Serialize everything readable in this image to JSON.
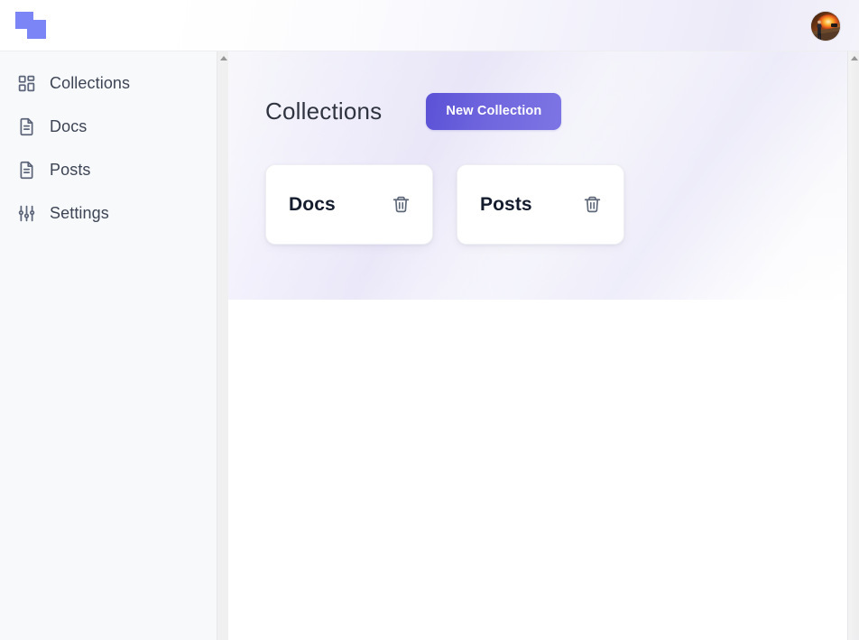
{
  "app": {
    "logo_name": "overlapping-squares-logo",
    "accent_color": "#6a61db",
    "logo_color": "#7c85f5",
    "sidebar_bg": "#f8f9fb"
  },
  "topbar": {
    "avatar_alt": "user-avatar"
  },
  "sidebar": {
    "items": [
      {
        "label": "Collections",
        "icon": "grid-icon"
      },
      {
        "label": "Docs",
        "icon": "document-icon"
      },
      {
        "label": "Posts",
        "icon": "document-icon"
      },
      {
        "label": "Settings",
        "icon": "sliders-icon"
      }
    ]
  },
  "main": {
    "page_title": "Collections",
    "new_collection_label": "New Collection",
    "collections": [
      {
        "name": "Docs",
        "delete_icon": "trash-icon"
      },
      {
        "name": "Posts",
        "delete_icon": "trash-icon"
      }
    ]
  }
}
